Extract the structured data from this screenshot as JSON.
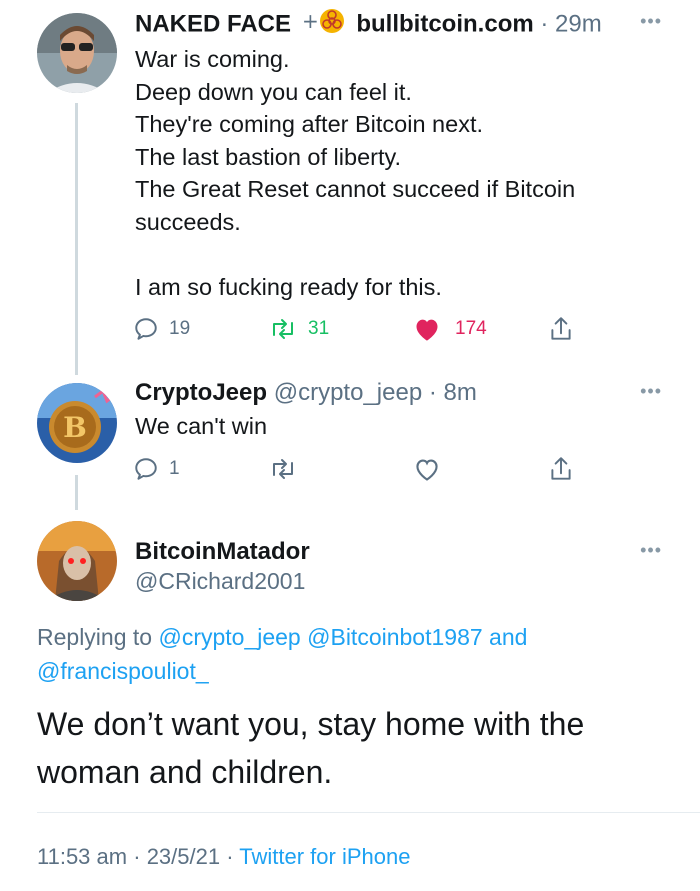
{
  "tweets": [
    {
      "name": "NAKED FACE",
      "badge_icon": "biohazard-icon",
      "handle": "bullbitcoin.com",
      "time": "29m",
      "text_lines": [
        "War is coming.",
        "Deep down you can feel it.",
        "They're coming after Bitcoin next.",
        "The last bastion of liberty.",
        "The Great Reset cannot succeed if Bitcoin",
        "succeeds.",
        "",
        "I am so fucking ready for this."
      ],
      "reply_count": "19",
      "retweet_count": "31",
      "like_count": "174",
      "liked": true
    },
    {
      "name": "CryptoJeep",
      "handle": "@crypto_jeep",
      "time": "8m",
      "text_lines": [
        "We can't win"
      ],
      "reply_count": "1",
      "retweet_count": "",
      "like_count": "",
      "liked": false
    }
  ],
  "main_tweet": {
    "name": "BitcoinMatador",
    "handle": "@CRichard2001",
    "replying_prefix": "Replying to",
    "replying_mentions": [
      "@crypto_jeep",
      "@Bitcoinbot1987",
      "and",
      "@francispouliot_"
    ],
    "text": "We don’t want you, stay home with the woman and children.",
    "time": "11:53 am",
    "date": "23/5/21",
    "source": "Twitter for iPhone"
  },
  "separators": {
    "dot": "·"
  },
  "colors": {
    "link": "#1da1f2",
    "retweet": "#17bf63",
    "like": "#e0245e",
    "muted": "#5b7083"
  }
}
